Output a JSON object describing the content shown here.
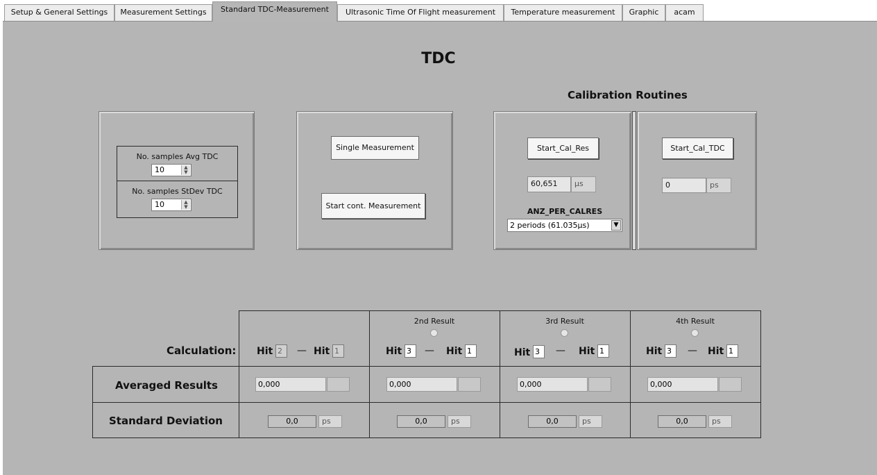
{
  "tabs": [
    {
      "label": "Setup & General Settings"
    },
    {
      "label": "Measurement Settings"
    },
    {
      "label": "Standard TDC-Measurement"
    },
    {
      "label": "Ultrasonic Time Of Flight measurement"
    },
    {
      "label": "Temperature measurement"
    },
    {
      "label": "Graphic"
    },
    {
      "label": "acam"
    }
  ],
  "active_tab": "Standard TDC-Measurement",
  "page": {
    "title": "TDC",
    "calibration_title": "Calibration Routines"
  },
  "samples": {
    "avg_label": "No. samples Avg TDC",
    "avg_value": "10",
    "stdev_label": "No. samples StDev TDC",
    "stdev_value": "10"
  },
  "measure": {
    "single": "Single Measurement",
    "continuous": "Start cont. Measurement"
  },
  "cal_res": {
    "button": "Start_Cal_Res",
    "value": "60,651",
    "unit": "µs",
    "combo_label": "ANZ_PER_CALRES",
    "combo_value": "2 periods (61.035µs)"
  },
  "cal_tdc": {
    "button": "Start_Cal_TDC",
    "value": "0",
    "unit": "ps"
  },
  "results": {
    "calc_label": "Calculation:",
    "avg_label": "Averaged Results",
    "std_label": "Standard Deviation",
    "hit_label": "Hit",
    "columns": [
      {
        "header": "",
        "hit_a": "2",
        "hit_b": "1",
        "avg": "0,000",
        "std": "0,0",
        "std_unit": "ps"
      },
      {
        "header": "2nd Result",
        "hit_a": "3",
        "hit_b": "1",
        "avg": "0,000",
        "std": "0,0",
        "std_unit": "ps"
      },
      {
        "header": "3rd Result",
        "hit_a": "3",
        "hit_b": "1",
        "avg": "0,000",
        "std": "0,0",
        "std_unit": "ps"
      },
      {
        "header": "4th Result",
        "hit_a": "3",
        "hit_b": "1",
        "avg": "0,000",
        "std": "0,0",
        "std_unit": "ps"
      }
    ]
  },
  "icons": {
    "spin": "spinner-arrows-icon",
    "dropdown": "chevron-down-icon",
    "radio": "radio-button-icon"
  }
}
